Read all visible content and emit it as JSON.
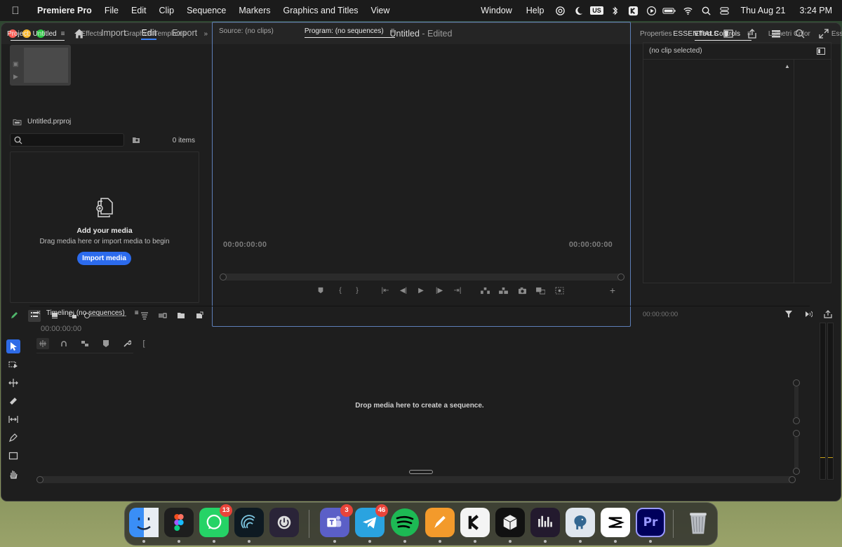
{
  "menubar": {
    "app_name": "Premiere Pro",
    "items": [
      "File",
      "Edit",
      "Clip",
      "Sequence",
      "Markers",
      "Graphics and Titles",
      "View"
    ],
    "right_items": [
      "Window",
      "Help"
    ],
    "keyboard_layout": "US",
    "date": "Thu Aug 21",
    "time": "3:24 PM"
  },
  "window": {
    "tabs": [
      "Import",
      "Edit",
      "Export"
    ],
    "active_tab": "Edit",
    "doc_title": "Untitled",
    "doc_status": " - Edited",
    "workspace": "ESSENTIALS"
  },
  "project": {
    "tabs": [
      "Project: Untitled",
      "Effects",
      "Graphics Templates"
    ],
    "file_name": "Untitled.prproj",
    "search_placeholder": "",
    "items_count": "0 items",
    "drop_title": "Add your media",
    "drop_subtitle": "Drag media here or import media to begin",
    "import_button": "Import media"
  },
  "monitor": {
    "tabs": [
      "Source: (no clips)",
      "Program: (no sequences)"
    ],
    "tc_left": "00:00:00:00",
    "tc_right": "00:00:00:00"
  },
  "effects": {
    "tabs": [
      "Properties",
      "Effect Controls",
      "Lumetri Color",
      "Essi"
    ],
    "no_clip": "(no clip selected)",
    "timecode": "00:00:00:00"
  },
  "timeline": {
    "title": "Timeline: (no sequences)",
    "timecode": "00:00:00:00",
    "drop_text": "Drop media here to create a sequence."
  },
  "dock": {
    "apps": [
      {
        "name": "Finder",
        "color": "#3a8ef6"
      },
      {
        "name": "Figma",
        "color": "#1e1e1e"
      },
      {
        "name": "WhatsApp",
        "color": "#25d366",
        "badge": "13"
      },
      {
        "name": "Coherence",
        "color": "#0e1a22"
      },
      {
        "name": "Power",
        "color": "#2a2438"
      },
      {
        "name": "Teams",
        "color": "#5b5fc7",
        "badge": "3"
      },
      {
        "name": "Telegram",
        "color": "#2aa3e0",
        "badge": "46"
      },
      {
        "name": "Spotify",
        "color": "#1db954"
      },
      {
        "name": "Pages",
        "color": "#f39a2b"
      },
      {
        "name": "Klack",
        "color": "#f4f4f4"
      },
      {
        "name": "Cube",
        "color": "#111111"
      },
      {
        "name": "Equalizer",
        "color": "#231a2e"
      },
      {
        "name": "Postgres",
        "color": "#dfe6ee"
      },
      {
        "name": "CapCut",
        "color": "#ffffff"
      },
      {
        "name": "Premiere Pro",
        "label": "Pr",
        "color": "#00005b"
      },
      {
        "name": "Trash",
        "color": "#666666"
      }
    ]
  }
}
